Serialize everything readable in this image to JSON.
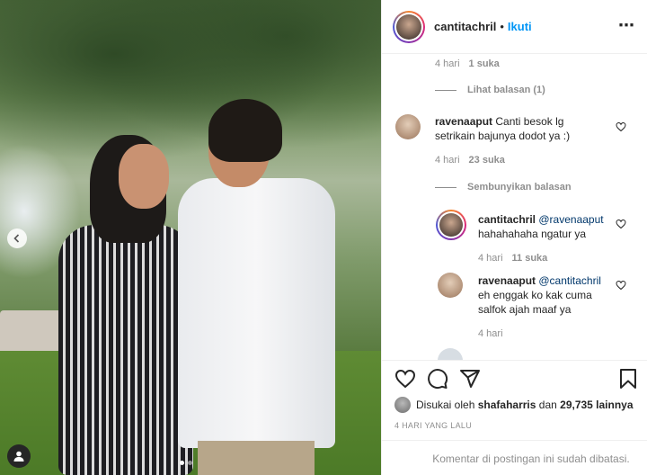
{
  "post": {
    "username": "cantitachril",
    "separator": "•",
    "follow_label": "Ikuti",
    "more_icon": "⋯"
  },
  "comments": {
    "first_meta": {
      "time": "4 hari",
      "likes": "1 suka"
    },
    "first_toggle": "Lihat balasan (1)",
    "main": {
      "username": "ravenaaput",
      "text_line1": "Canti besok lg",
      "text_line2": "setrikain bajunya dodot ya :)",
      "time": "4 hari",
      "likes": "23 suka"
    },
    "second_toggle": "Sembunyikan balasan",
    "reply1": {
      "username": "cantitachril",
      "mention": "@ravenaaput",
      "text": "hahahahaha ngatur ya",
      "time": "4 hari",
      "likes": "11 suka"
    },
    "reply2": {
      "username": "ravenaaput",
      "mention": "@cantitachril",
      "text_line1": "eh enggak ko kak cuma",
      "text_line2": "salfok ajah maaf ya",
      "time": "4 hari"
    }
  },
  "engagement": {
    "liked_prefix": "Disukai oleh",
    "liked_user": "shafaharris",
    "liked_and": "dan",
    "liked_count": "29,735 lainnya",
    "time_ago": "4 HARI YANG LALU",
    "comments_closed": "Komentar di postingan ini sudah dibatasi."
  },
  "colors": {
    "link_blue": "#0095f6",
    "mention": "#00376b",
    "muted": "#8e8e8e"
  }
}
